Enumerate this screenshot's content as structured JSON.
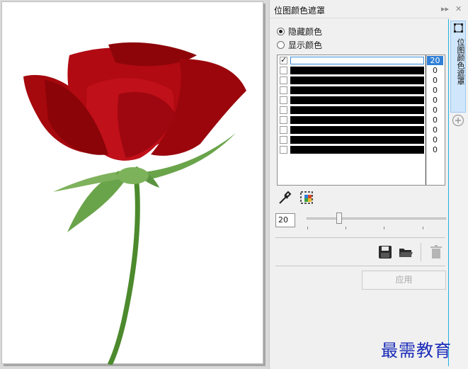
{
  "canvas": {
    "image_subject": "rose-photo"
  },
  "docker": {
    "title": "位图颜色遮罩",
    "modes": [
      {
        "label": "隐藏颜色",
        "selected": true
      },
      {
        "label": "显示颜色",
        "selected": false
      }
    ],
    "color_rows": [
      {
        "checked": true,
        "tolerance": "20",
        "selected": true
      },
      {
        "checked": false,
        "tolerance": "0",
        "selected": false
      },
      {
        "checked": false,
        "tolerance": "0",
        "selected": false
      },
      {
        "checked": false,
        "tolerance": "0",
        "selected": false
      },
      {
        "checked": false,
        "tolerance": "0",
        "selected": false
      },
      {
        "checked": false,
        "tolerance": "0",
        "selected": false
      },
      {
        "checked": false,
        "tolerance": "0",
        "selected": false
      },
      {
        "checked": false,
        "tolerance": "0",
        "selected": false
      },
      {
        "checked": false,
        "tolerance": "0",
        "selected": false
      },
      {
        "checked": false,
        "tolerance": "0",
        "selected": false
      }
    ],
    "tolerance_value": "20",
    "tolerance_slider": {
      "value": 20,
      "min": 0,
      "max": 100
    },
    "apply_label": "应用",
    "icons": {
      "eyedropper": "eyedropper-icon",
      "color_select": "color-select-icon",
      "save": "save-icon",
      "open": "open-folder-icon",
      "delete": "trash-icon"
    }
  },
  "side_tab": {
    "label": "位图颜色遮罩"
  },
  "watermark": "最需教育",
  "colors": {
    "accent": "#22b0e0",
    "selection": "#2f7fd6",
    "watermark": "#1a2bb8"
  }
}
